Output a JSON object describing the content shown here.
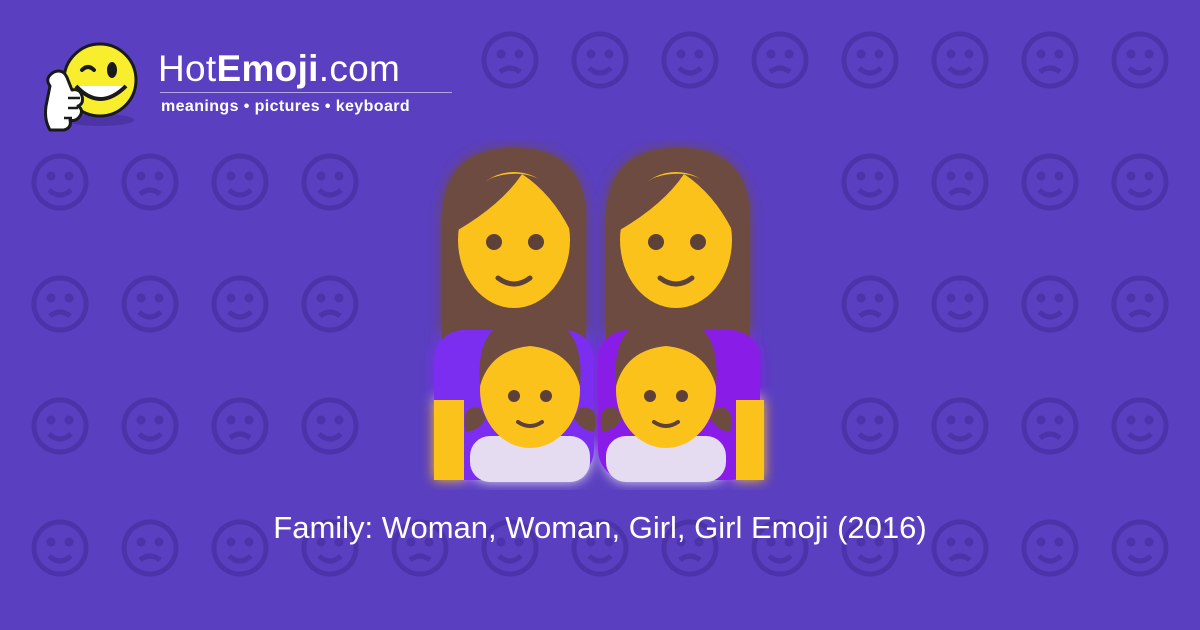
{
  "site": {
    "brand_prefix": "Hot",
    "brand_bold": "Emoji",
    "brand_suffix": ".com",
    "tagline": "meanings • pictures • keyboard"
  },
  "emoji": {
    "caption": "Family: Woman, Woman, Girl, Girl Emoji (2016)",
    "icon": "family-woman-woman-girl-girl-icon"
  },
  "colors": {
    "background": "#5a3fc0",
    "pattern": "#4e35ad",
    "skin": "#fcc21b",
    "hair": "#6d4c41",
    "shirt_left": "#7b2ff0",
    "shirt_right": "#8a1fe8",
    "girl_shirt": "#e6dcf2"
  }
}
